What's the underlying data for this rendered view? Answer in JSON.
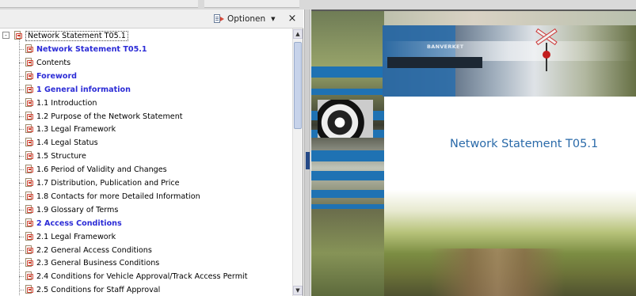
{
  "toolbar": {
    "options_label": "Optionen",
    "options_caret": "▼",
    "close_glyph": "×"
  },
  "tree": {
    "root": {
      "label": "Network Statement T05.1",
      "expander": "-"
    },
    "items": [
      {
        "label": "Network Statement T05.1",
        "bold": true
      },
      {
        "label": "Contents",
        "bold": false
      },
      {
        "label": "Foreword",
        "bold": true
      },
      {
        "label": "1 General information",
        "bold": true
      },
      {
        "label": "1.1 Introduction",
        "bold": false
      },
      {
        "label": "1.2 Purpose of the Network Statement",
        "bold": false
      },
      {
        "label": "1.3 Legal Framework",
        "bold": false
      },
      {
        "label": "1.4 Legal Status",
        "bold": false
      },
      {
        "label": "1.5 Structure",
        "bold": false
      },
      {
        "label": "1.6 Period of Validity and Changes",
        "bold": false
      },
      {
        "label": "1.7 Distribution, Publication and Price",
        "bold": false
      },
      {
        "label": "1.8 Contacts for more Detailed Information",
        "bold": false
      },
      {
        "label": "1.9 Glossary of Terms",
        "bold": false
      },
      {
        "label": "2 Access Conditions",
        "bold": true
      },
      {
        "label": "2.1 Legal Framework",
        "bold": false
      },
      {
        "label": "2.2 General Access Conditions",
        "bold": false
      },
      {
        "label": "2.3 General Business Conditions",
        "bold": false
      },
      {
        "label": "2.4 Conditions for Vehicle Approval/Track Access Permit",
        "bold": false
      },
      {
        "label": "2.5 Conditions for Staff Approval",
        "bold": false
      }
    ]
  },
  "scrollbar": {
    "up": "▲",
    "down": "▼"
  },
  "document": {
    "cover_title": "Network Statement T05.1",
    "brand": "BANVERKET"
  },
  "colors": {
    "bookmark_bold": "#2b2bd6",
    "cover_blue": "#1f72b3",
    "title_blue": "#2a6aa9"
  }
}
